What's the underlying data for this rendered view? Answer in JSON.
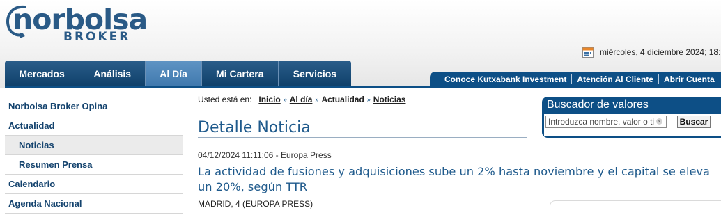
{
  "brand": {
    "name": "norbolsa",
    "sub": "BROKER"
  },
  "date_bar": {
    "text": "miércoles, 4 diciembre 2024; 18:",
    "icon": "calendar-icon"
  },
  "main_nav": [
    {
      "label": "Mercados"
    },
    {
      "label": "Análisis"
    },
    {
      "label": "Al Día",
      "active": true
    },
    {
      "label": "Mi Cartera"
    },
    {
      "label": "Servicios"
    }
  ],
  "top_links": [
    {
      "label": "Conoce Kutxabank Investment"
    },
    {
      "label": "Atención Al Cliente"
    },
    {
      "label": "Abrir Cuenta"
    }
  ],
  "sidebar": [
    {
      "label": "Norbolsa Broker Opina",
      "level": 1
    },
    {
      "label": "Actualidad",
      "level": 1
    },
    {
      "label": "Noticias",
      "level": 2,
      "active": true
    },
    {
      "label": "Resumen Prensa",
      "level": 2
    },
    {
      "label": "Calendario",
      "level": 1
    },
    {
      "label": "Agenda Nacional",
      "level": 1
    }
  ],
  "breadcrumb": {
    "prefix": "Usted está en:",
    "items": [
      {
        "label": "Inicio",
        "link": true
      },
      {
        "label": "Al día",
        "link": true
      },
      {
        "label": "Actualidad",
        "link": false
      },
      {
        "label": "Noticias",
        "link": true
      }
    ]
  },
  "article": {
    "section_title": "Detalle Noticia",
    "meta": "04/12/2024 11:11:06 - Europa Press",
    "headline": "La actividad de fusiones y adquisiciones sube un 2% hasta noviembre y el capital se eleva un 20%, según TTR",
    "dateline": "MADRID, 4 (EUROPA PRESS)"
  },
  "search": {
    "title": "Buscador de valores",
    "placeholder": "Introduzca nombre, valor o ti",
    "button": "Buscar"
  },
  "colors": {
    "brand_blue": "#0d4f86",
    "nav_active": "#3f78ad",
    "title_blue": "#1f5a8c"
  }
}
